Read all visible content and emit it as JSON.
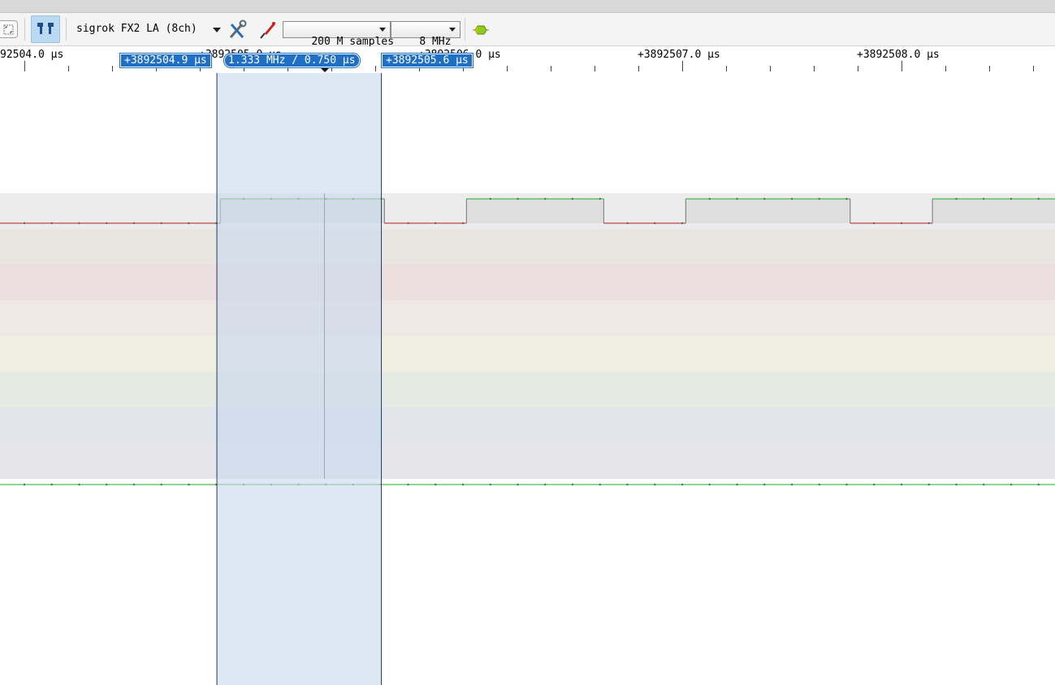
{
  "toolbar": {
    "device": "sigrok FX2 LA (8ch)",
    "sample_count": "200 M samples",
    "sample_rate": "8 MHz",
    "icons": [
      "zoom-fit-icon",
      "sticky-scroll-icon",
      "configure-icon",
      "probe-icon",
      "run-icon"
    ]
  },
  "ruler": {
    "labels": [
      "92504.0 μs",
      "+3892505.0 μs",
      "+3892506.0 μs",
      "+3892507.0 μs",
      "+3892508.0 μs"
    ]
  },
  "cursors": {
    "left_label": "+3892504.9 μs",
    "measure_label": "1.333 MHz / 0.750 μs",
    "right_label": "+3892505.6 μs"
  },
  "colors": {
    "cursor_fill": "#c9d9ee",
    "cursor_flag": "#1f6fc4",
    "trace_high": "#1fb31f",
    "trace_low": "#b41c1c",
    "channel_bands": [
      "#ececec",
      "#e9e6e2",
      "#ecdfdf",
      "#f0e8e3",
      "#f0efe1",
      "#e5ebe3",
      "#e2e6ec",
      "#e6e6ea"
    ]
  },
  "channels": [
    {
      "index": 0,
      "edges_us": [
        3892504.894,
        3892505.642,
        3892506.016,
        3892506.642,
        3892507.016,
        3892507.766,
        3892508.141
      ],
      "initial": "low"
    },
    {
      "index": 1,
      "level": "high"
    },
    {
      "index": 2,
      "level": "high"
    },
    {
      "index": 3,
      "level": "high"
    },
    {
      "index": 4,
      "level": "high"
    },
    {
      "index": 5,
      "level": "high"
    },
    {
      "index": 6,
      "level": "high"
    },
    {
      "index": 7,
      "level": "high"
    }
  ]
}
